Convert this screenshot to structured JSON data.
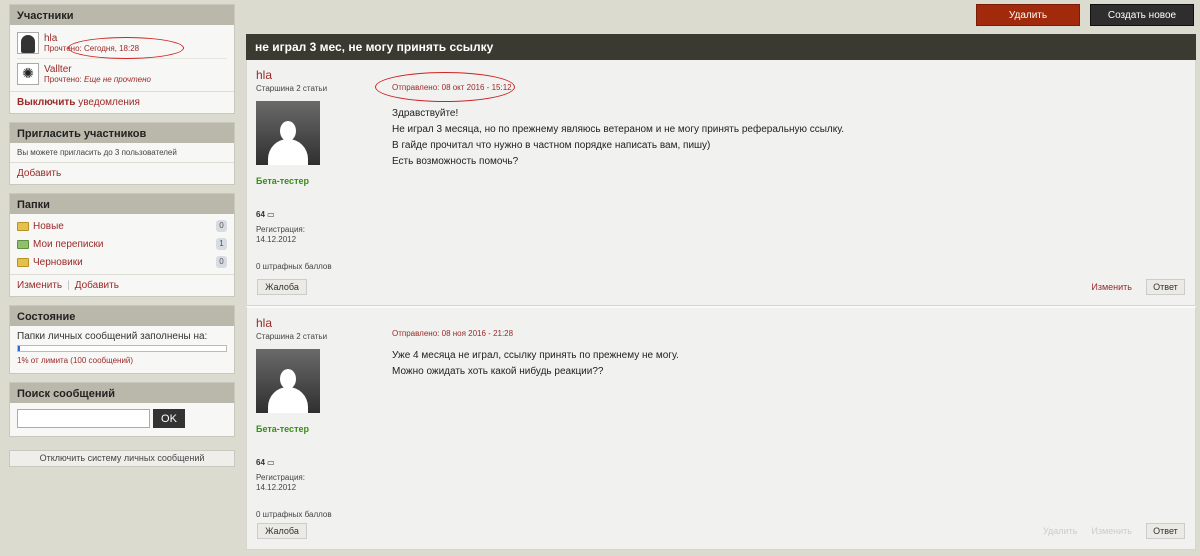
{
  "sidebar": {
    "members": {
      "title": "Участники",
      "list": [
        {
          "name": "hla",
          "status_prefix": "Прочтено:",
          "status": "Сегодня, 18:28"
        },
        {
          "name": "Vallter",
          "status_prefix": "Прочтено:",
          "status": "Еще не прочтено"
        }
      ],
      "footer_link": "Выключить",
      "footer_rest": "уведомления"
    },
    "invite": {
      "title": "Пригласить участников",
      "text": "Вы можете пригласить до 3 пользователей",
      "add": "Добавить"
    },
    "folders": {
      "title": "Папки",
      "list": [
        {
          "name": "Новые",
          "count": "0"
        },
        {
          "name": "Мои переписки",
          "count": "1"
        },
        {
          "name": "Черновики",
          "count": "0"
        }
      ],
      "edit": "Изменить",
      "add": "Добавить"
    },
    "status": {
      "title": "Состояние",
      "text": "Папки личных сообщений заполнены на:",
      "progress": 0.01,
      "usage": "1% от лимита (100 сообщений)"
    },
    "search": {
      "title": "Поиск сообщений",
      "placeholder": "",
      "button": "OK"
    },
    "disable_button": "Отключить систему личных сообщений"
  },
  "toolbar": {
    "delete": "Удалить",
    "create": "Создать новое"
  },
  "topic": {
    "title": "не играл 3 мес, не могу принять ссылку"
  },
  "posts": [
    {
      "author": "hla",
      "rank": "Старшина 2 статьи",
      "role": "Бета-тестер",
      "messages": "64",
      "reg_label": "Регистрация:",
      "reg_date": "14.12.2012",
      "warnings": "0 штрафных баллов",
      "sent": "Отправлено: 08 окт 2016 - 15:12",
      "lines": [
        "Здравствуйте!",
        "Не играл 3 месяца, но по прежнему являюсь ветераном и не могу принять реферальную ссылку.",
        "В гайде прочитал что нужно в частном порядке написать вам, пишу)",
        "Есть возможность помочь?"
      ],
      "complaint": "Жалоба",
      "edit": "Изменить",
      "reply": "Ответ"
    },
    {
      "author": "hla",
      "rank": "Старшина 2 статьи",
      "role": "Бета-тестер",
      "messages": "64",
      "reg_label": "Регистрация:",
      "reg_date": "14.12.2012",
      "warnings": "0 штрафных баллов",
      "sent": "Отправлено: 08 ноя 2016 - 21:28",
      "lines": [
        "Уже 4 месяца не играл, ссылку принять по прежнему не могу.",
        "Можно ожидать хоть какой нибудь реакции??"
      ],
      "complaint": "Жалоба",
      "delete": "Удалить",
      "edit": "Изменить",
      "reply": "Ответ"
    }
  ]
}
